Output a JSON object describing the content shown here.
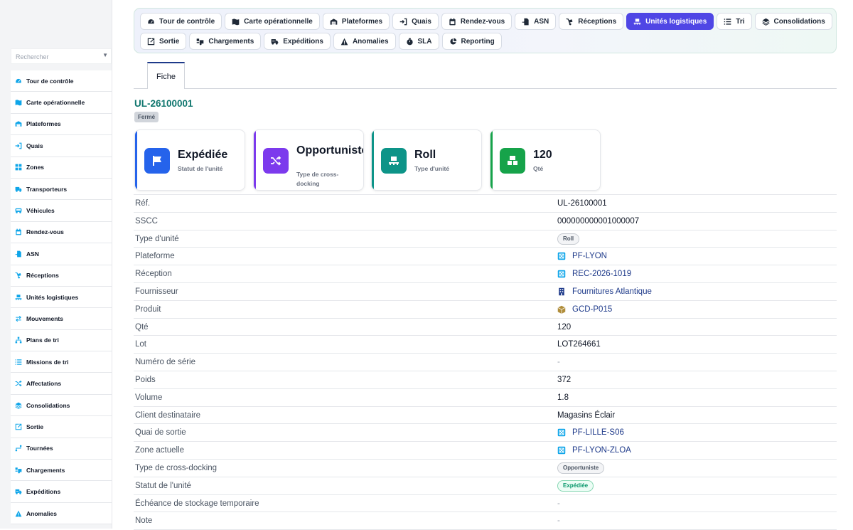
{
  "search": {
    "placeholder": "Rechercher"
  },
  "sidebar": {
    "items": [
      {
        "label": "Tour de contrôle",
        "icon": "gauge-icon"
      },
      {
        "label": "Carte opérationnelle",
        "icon": "map-icon"
      },
      {
        "label": "Plateformes",
        "icon": "warehouse-icon"
      },
      {
        "label": "Quais",
        "icon": "sign-in-icon"
      },
      {
        "label": "Zones",
        "icon": "grid-icon"
      },
      {
        "label": "Transporteurs",
        "icon": "truck-icon"
      },
      {
        "label": "Véhicules",
        "icon": "bus-icon"
      },
      {
        "label": "Rendez-vous",
        "icon": "calendar-icon"
      },
      {
        "label": "ASN",
        "icon": "file-import-icon"
      },
      {
        "label": "Réceptions",
        "icon": "dolly-icon"
      },
      {
        "label": "Unités logistiques",
        "icon": "pallet-icon"
      },
      {
        "label": "Mouvements",
        "icon": "exchange-icon"
      },
      {
        "label": "Plans de tri",
        "icon": "sitemap-icon"
      },
      {
        "label": "Missions de tri",
        "icon": "list-icon"
      },
      {
        "label": "Affectations",
        "icon": "shuffle-icon"
      },
      {
        "label": "Consolidations",
        "icon": "layers-icon"
      },
      {
        "label": "Sortie",
        "icon": "exit-icon"
      },
      {
        "label": "Tournées",
        "icon": "route-icon"
      },
      {
        "label": "Chargements",
        "icon": "truck-loading-icon"
      },
      {
        "label": "Expéditions",
        "icon": "shipping-icon"
      },
      {
        "label": "Anomalies",
        "icon": "warning-icon"
      }
    ]
  },
  "topnav": {
    "row1": [
      {
        "label": "Tour de contrôle",
        "icon": "gauge-icon"
      },
      {
        "label": "Carte opérationnelle",
        "icon": "map-icon"
      },
      {
        "label": "Plateformes",
        "icon": "warehouse-icon"
      },
      {
        "label": "Quais",
        "icon": "sign-in-icon"
      },
      {
        "label": "Rendez-vous",
        "icon": "calendar-icon"
      },
      {
        "label": "ASN",
        "icon": "file-import-icon"
      },
      {
        "label": "Réceptions",
        "icon": "dolly-icon"
      },
      {
        "label": "Unités logistiques",
        "icon": "pallet-icon",
        "active": true
      },
      {
        "label": "Tri",
        "icon": "list-icon"
      },
      {
        "label": "Consolidations",
        "icon": "layers-icon"
      }
    ],
    "row2": [
      {
        "label": "Sortie",
        "icon": "exit-icon"
      },
      {
        "label": "Chargements",
        "icon": "truck-loading-icon"
      },
      {
        "label": "Expéditions",
        "icon": "shipping-icon"
      },
      {
        "label": "Anomalies",
        "icon": "warning-icon"
      },
      {
        "label": "SLA",
        "icon": "stopwatch-icon"
      },
      {
        "label": "Reporting",
        "icon": "pie-icon"
      }
    ]
  },
  "record": {
    "tab_label": "Fiche",
    "title": "UL-26100001",
    "state": "Fermé"
  },
  "cards": [
    {
      "value": "Expédiée",
      "caption": "Statut de l'unité",
      "icon": "flag-icon",
      "color": "#2563eb"
    },
    {
      "value": "Opportuniste",
      "caption": "Type de cross-docking",
      "icon": "shuffle-icon",
      "color": "#7c3aed"
    },
    {
      "value": "Roll",
      "caption": "Type d'unité",
      "icon": "pallet-icon",
      "color": "#0d9488"
    },
    {
      "value": "120",
      "caption": "Qté",
      "icon": "boxes-icon",
      "color": "#16a34a"
    }
  ],
  "fields": [
    {
      "label": "Réf.",
      "value": "UL-26100001",
      "kind": "text"
    },
    {
      "label": "SSCC",
      "value": "000000000001000007",
      "kind": "text"
    },
    {
      "label": "Type d'unité",
      "value": "Roll",
      "kind": "pill-grey"
    },
    {
      "label": "Plateforme",
      "value": "PF-LYON",
      "kind": "link",
      "icon": "cube-icon"
    },
    {
      "label": "Réception",
      "value": "REC-2026-1019",
      "kind": "link",
      "icon": "cube-icon"
    },
    {
      "label": "Fournisseur",
      "value": "Fournitures Atlantique",
      "kind": "link",
      "icon": "building-icon"
    },
    {
      "label": "Produit",
      "value": "GCD-P015",
      "kind": "link",
      "icon": "box-icon"
    },
    {
      "label": "Qté",
      "value": "120",
      "kind": "text"
    },
    {
      "label": "Lot",
      "value": "LOT264661",
      "kind": "text"
    },
    {
      "label": "Numéro de série",
      "value": "-",
      "kind": "dash"
    },
    {
      "label": "Poids",
      "value": "372",
      "kind": "text"
    },
    {
      "label": "Volume",
      "value": "1.8",
      "kind": "text"
    },
    {
      "label": "Client destinataire",
      "value": "Magasins Éclair",
      "kind": "text"
    },
    {
      "label": "Quai de sortie",
      "value": "PF-LILLE-S06",
      "kind": "link",
      "icon": "cube-icon"
    },
    {
      "label": "Zone actuelle",
      "value": "PF-LYON-ZLOA",
      "kind": "link",
      "icon": "cube-icon"
    },
    {
      "label": "Type de cross-docking",
      "value": "Opportuniste",
      "kind": "pill-grey"
    },
    {
      "label": "Statut de l'unité",
      "value": "Expédiée",
      "kind": "pill-green"
    },
    {
      "label": "Échéance de stockage temporaire",
      "value": "-",
      "kind": "dash"
    },
    {
      "label": "Note",
      "value": "-",
      "kind": "dash"
    }
  ],
  "colors": {
    "accent": "#4f46e5",
    "teal_title": "#0f766e",
    "link": "#1e3a8a",
    "nav_icon": "#0ea5e9"
  }
}
